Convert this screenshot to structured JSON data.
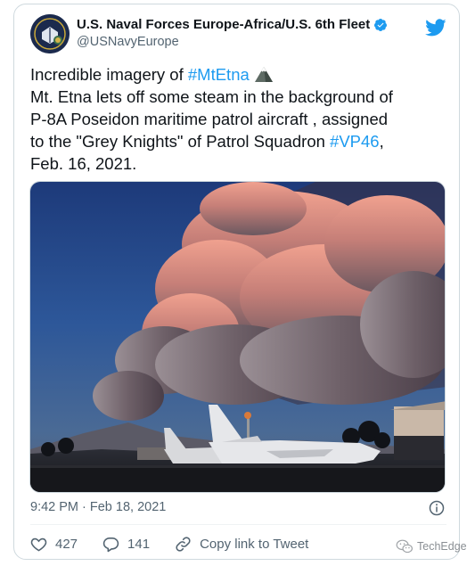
{
  "author": {
    "display_name": "U.S. Naval Forces Europe-Africa/U.S. 6th Fleet",
    "handle": "@USNavyEurope",
    "verified": true
  },
  "tweet": {
    "line1_text": "Incredible imagery of ",
    "line1_hashtag": "#MtEtna",
    "emoji": "mountain-emoji",
    "line2": "Mt. Etna lets off some steam in the background of",
    "line3": "P-8A Poseidon maritime patrol aircraft , assigned",
    "line4_text": "to the \"Grey Knights\" of Patrol Squadron ",
    "line4_hashtag": "#VP46",
    "line4_end": ",",
    "line5": "Feb. 16, 2021."
  },
  "timestamp": "9:42 PM · Feb 18, 2021",
  "actions": {
    "likes": "427",
    "replies": "141",
    "copy_link": "Copy link to Tweet"
  },
  "watermark": "TechEdge",
  "colors": {
    "link": "#1d9bf0",
    "secondary_text": "#536471",
    "border": "#cfd9de"
  }
}
